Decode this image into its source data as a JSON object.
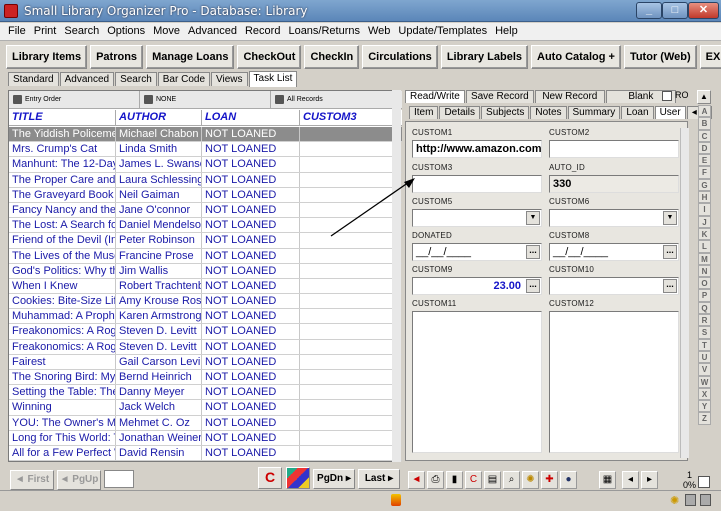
{
  "window": {
    "title": "Small Library Organizer Pro - Database: Library"
  },
  "menu": [
    "File",
    "Print",
    "Search",
    "Options",
    "Move",
    "Advanced",
    "Record",
    "Loans/Returns",
    "Web",
    "Update/Templates",
    "Help"
  ],
  "toolbar": [
    "Library Items",
    "Patrons",
    "Manage Loans",
    "CheckOut",
    "CheckIn",
    "Circulations",
    "Library Labels",
    "Auto Catalog +",
    "Tutor (Web)",
    "EXIT"
  ],
  "subtabs": [
    "Standard",
    "Advanced",
    "Search",
    "Bar Code",
    "Views",
    "Task List"
  ],
  "grid": {
    "sort1": "Entry Order",
    "sort2": "NONE",
    "sort3": "All Records",
    "headers": [
      "TITLE",
      "AUTHOR",
      "LOAN",
      "CUSTOM3"
    ],
    "rows": [
      [
        "The Yiddish Policemen",
        "Michael Chabon",
        "NOT LOANED",
        ""
      ],
      [
        "Mrs. Crump's Cat",
        "Linda Smith",
        "NOT LOANED",
        ""
      ],
      [
        "Manhunt: The 12-Day",
        "James L. Swanson",
        "NOT LOANED",
        ""
      ],
      [
        "The Proper Care and F",
        "Laura Schlessinger",
        "NOT LOANED",
        ""
      ],
      [
        "The Graveyard Book",
        "Neil Gaiman",
        "NOT LOANED",
        ""
      ],
      [
        "Fancy Nancy and the B",
        "Jane O'connor",
        "NOT LOANED",
        ""
      ],
      [
        "The Lost: A Search for",
        "Daniel Mendelsohn",
        "NOT LOANED",
        ""
      ],
      [
        "Friend of the Devil (Ins",
        "Peter Robinson",
        "NOT LOANED",
        ""
      ],
      [
        "The Lives of the Muses",
        "Francine Prose",
        "NOT LOANED",
        ""
      ],
      [
        "God's Politics: Why th",
        "Jim Wallis",
        "NOT LOANED",
        ""
      ],
      [
        "When I Knew",
        "Robert Trachtenberg",
        "NOT LOANED",
        ""
      ],
      [
        "Cookies: Bite-Size Life",
        "Amy Krouse Rosenthal",
        "NOT LOANED",
        ""
      ],
      [
        "Muhammad: A Prophet",
        "Karen Armstrong",
        "NOT LOANED",
        ""
      ],
      [
        "Freakonomics: A Rogu",
        "Steven D. Levitt",
        "NOT LOANED",
        ""
      ],
      [
        "Freakonomics: A Rogu",
        "Steven D. Levitt",
        "NOT LOANED",
        ""
      ],
      [
        "Fairest",
        "Gail Carson Levine",
        "NOT LOANED",
        ""
      ],
      [
        "The Snoring Bird: My F",
        "Bernd Heinrich",
        "NOT LOANED",
        ""
      ],
      [
        "Setting the Table: The",
        "Danny Meyer",
        "NOT LOANED",
        ""
      ],
      [
        "Winning",
        "Jack Welch",
        "NOT LOANED",
        ""
      ],
      [
        "YOU: The Owner's Man",
        "Mehmet C. Oz",
        "NOT LOANED",
        ""
      ],
      [
        "Long for This World: Th",
        "Jonathan Weiner",
        "NOT LOANED",
        ""
      ],
      [
        "All for a Few Perfect W",
        "David Rensin",
        "NOT LOANED",
        ""
      ]
    ]
  },
  "nav": {
    "first": "First",
    "pgup": "PgUp",
    "pgdn": "PgDn",
    "last": "Last"
  },
  "right": {
    "top_tabs": [
      "Read/Write",
      "Save Record",
      "New Record",
      "Blank"
    ],
    "ro": "RO",
    "tabs": [
      "Item",
      "Details",
      "Subjects",
      "Notes",
      "Summary",
      "Loan",
      "User"
    ],
    "fields": {
      "custom1_label": "CUSTOM1",
      "custom1_value": "http://www.amazon.com",
      "custom2_label": "CUSTOM2",
      "custom2_value": "",
      "custom3_label": "CUSTOM3",
      "custom3_value": "",
      "autoid_label": "AUTO_ID",
      "autoid_value": "330",
      "custom5_label": "CUSTOM5",
      "custom6_label": "CUSTOM6",
      "donated_label": "DONATED",
      "donated_value": "__/__/____",
      "custom8_label": "CUSTOM8",
      "custom8_value": "__/__/____",
      "custom9_label": "CUSTOM9",
      "custom9_value": "23.00",
      "custom10_label": "CUSTOM10",
      "custom11_label": "CUSTOM11",
      "custom12_label": "CUSTOM12"
    }
  },
  "alpha": [
    "A",
    "B",
    "C",
    "D",
    "E",
    "F",
    "G",
    "H",
    "I",
    "J",
    "K",
    "L",
    "M",
    "N",
    "O",
    "P",
    "Q",
    "R",
    "S",
    "T",
    "U",
    "V",
    "W",
    "X",
    "Y",
    "Z"
  ],
  "status": {
    "percent": "0%",
    "one": "1"
  }
}
